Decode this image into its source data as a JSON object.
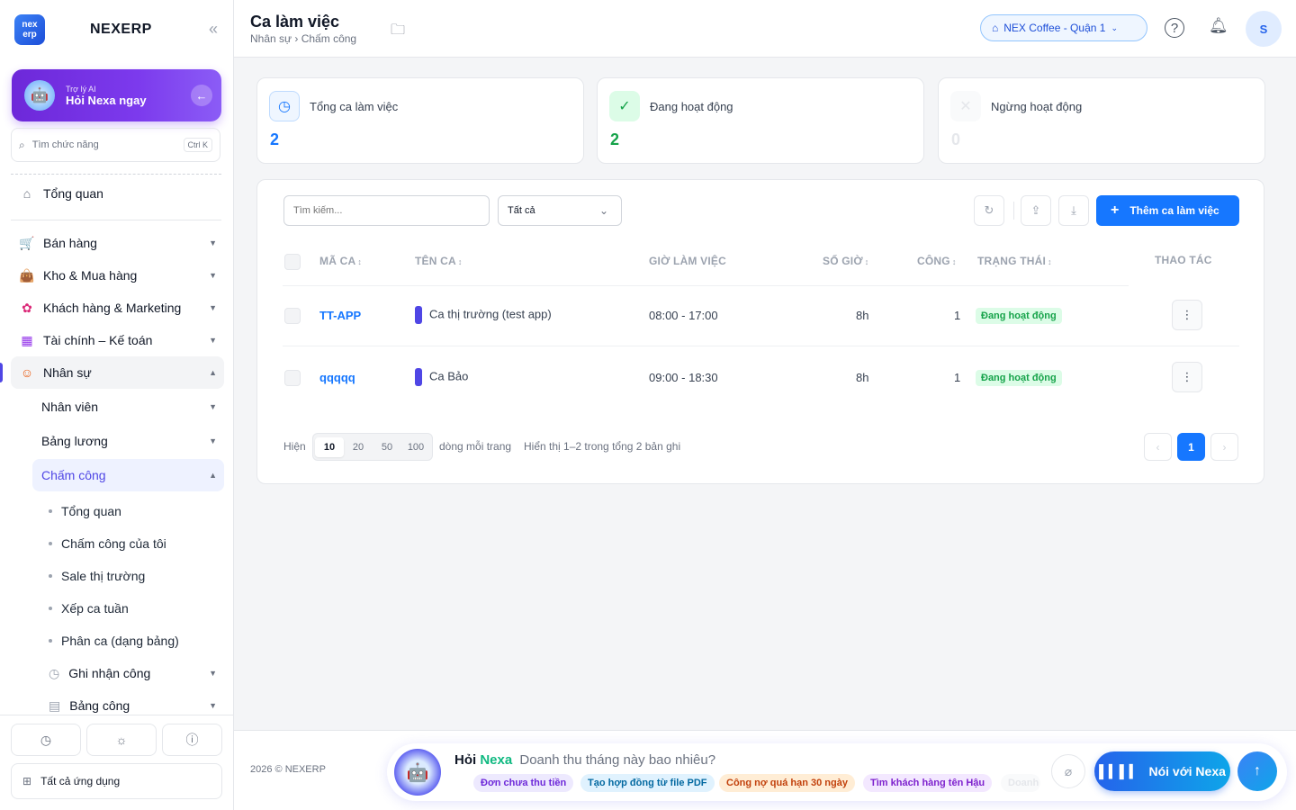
{
  "sidebar": {
    "brand": "NEXERP",
    "logo_text_1": "nex",
    "logo_text_2": "erp",
    "ai_small": "Trợ lý AI",
    "ai_big": "Hỏi Nexa ngay",
    "search_placeholder": "Tìm chức năng",
    "search_shortcut": "Ctrl K",
    "items": [
      {
        "label": "Tổng quan",
        "icon": "home-icon"
      },
      {
        "label": "Bán hàng",
        "icon": "cart-icon"
      },
      {
        "label": "Kho & Mua hàng",
        "icon": "bag-icon"
      },
      {
        "label": "Khách hàng & Marketing",
        "icon": "users-icon"
      },
      {
        "label": "Tài chính – Kế toán",
        "icon": "calculator-icon"
      },
      {
        "label": "Nhân sự",
        "icon": "person-icon"
      }
    ],
    "hr_sub": [
      {
        "label": "Nhân viên"
      },
      {
        "label": "Bảng lương"
      },
      {
        "label": "Chấm công"
      }
    ],
    "attendance_sub": [
      {
        "label": "Tổng quan"
      },
      {
        "label": "Chấm công của tôi"
      },
      {
        "label": "Sale thị trường"
      },
      {
        "label": "Xếp ca tuần"
      },
      {
        "label": "Phân ca (dạng bảng)"
      }
    ],
    "attendance_groups": [
      {
        "label": "Ghi nhận công",
        "icon": "clock-icon"
      },
      {
        "label": "Bảng công",
        "icon": "sheet-icon"
      }
    ],
    "all_apps": "Tất cả ứng dụng"
  },
  "topbar": {
    "title": "Ca làm việc",
    "breadcrumb": "Nhân sự › Chấm công",
    "store": "NEX Coffee - Quận 1",
    "avatar": "S"
  },
  "stats": [
    {
      "label": "Tổng ca làm việc",
      "value": "2",
      "color": "#1677ff"
    },
    {
      "label": "Đang hoạt động",
      "value": "2",
      "color": "#16a34a"
    },
    {
      "label": "Ngừng hoạt động",
      "value": "0",
      "color": "#d1d5db"
    }
  ],
  "toolbar": {
    "search_placeholder": "Tìm kiếm...",
    "filter_value": "Tất cả",
    "add_label": "Thêm ca làm việc"
  },
  "table": {
    "headers": {
      "code": "MÃ CA",
      "name": "TÊN CA",
      "hours": "GIỜ LÀM VIỆC",
      "count": "SỐ GIỜ",
      "work": "CÔNG",
      "status": "TRẠNG THÁI",
      "actions": "THAO TÁC"
    },
    "rows": [
      {
        "code": "TT-APP",
        "name": "Ca thị trường (test app)",
        "hours": "08:00 - 17:00",
        "count": "8h",
        "work": "1",
        "status": "Đang hoạt động"
      },
      {
        "code": "qqqqq",
        "name": "Ca Bảo",
        "hours": "09:00 - 18:30",
        "count": "8h",
        "work": "1",
        "status": "Đang hoạt động"
      }
    ]
  },
  "pagination": {
    "show": "Hiện",
    "sizes": [
      "10",
      "20",
      "50",
      "100"
    ],
    "per_page": "dòng mỗi trang",
    "summary": "Hiển thị 1–2 trong tổng 2 bản ghi",
    "current": "1"
  },
  "footer": {
    "copyright": "2026 © NEXERP",
    "ask_prefix": "Hỏi",
    "ask_brand": "Nexa",
    "ask_prompt": "Doanh thu tháng này bao nhiêu?",
    "chips": [
      {
        "label": "Đơn chưa thu tiền",
        "bg": "#ede9fe",
        "fg": "#6d28d9"
      },
      {
        "label": "Tạo hợp đồng từ file PDF",
        "bg": "#e0f2fe",
        "fg": "#0369a1"
      },
      {
        "label": "Công nợ quá hạn 30 ngày",
        "bg": "#ffedd5",
        "fg": "#c2410c"
      },
      {
        "label": "Tìm khách hàng tên Hậu",
        "bg": "#f3e8ff",
        "fg": "#7e22ce"
      },
      {
        "label": "Doanh",
        "bg": "#f3f4f6",
        "fg": "#d1d5db"
      }
    ],
    "talk_label": "Nói với Nexa"
  }
}
